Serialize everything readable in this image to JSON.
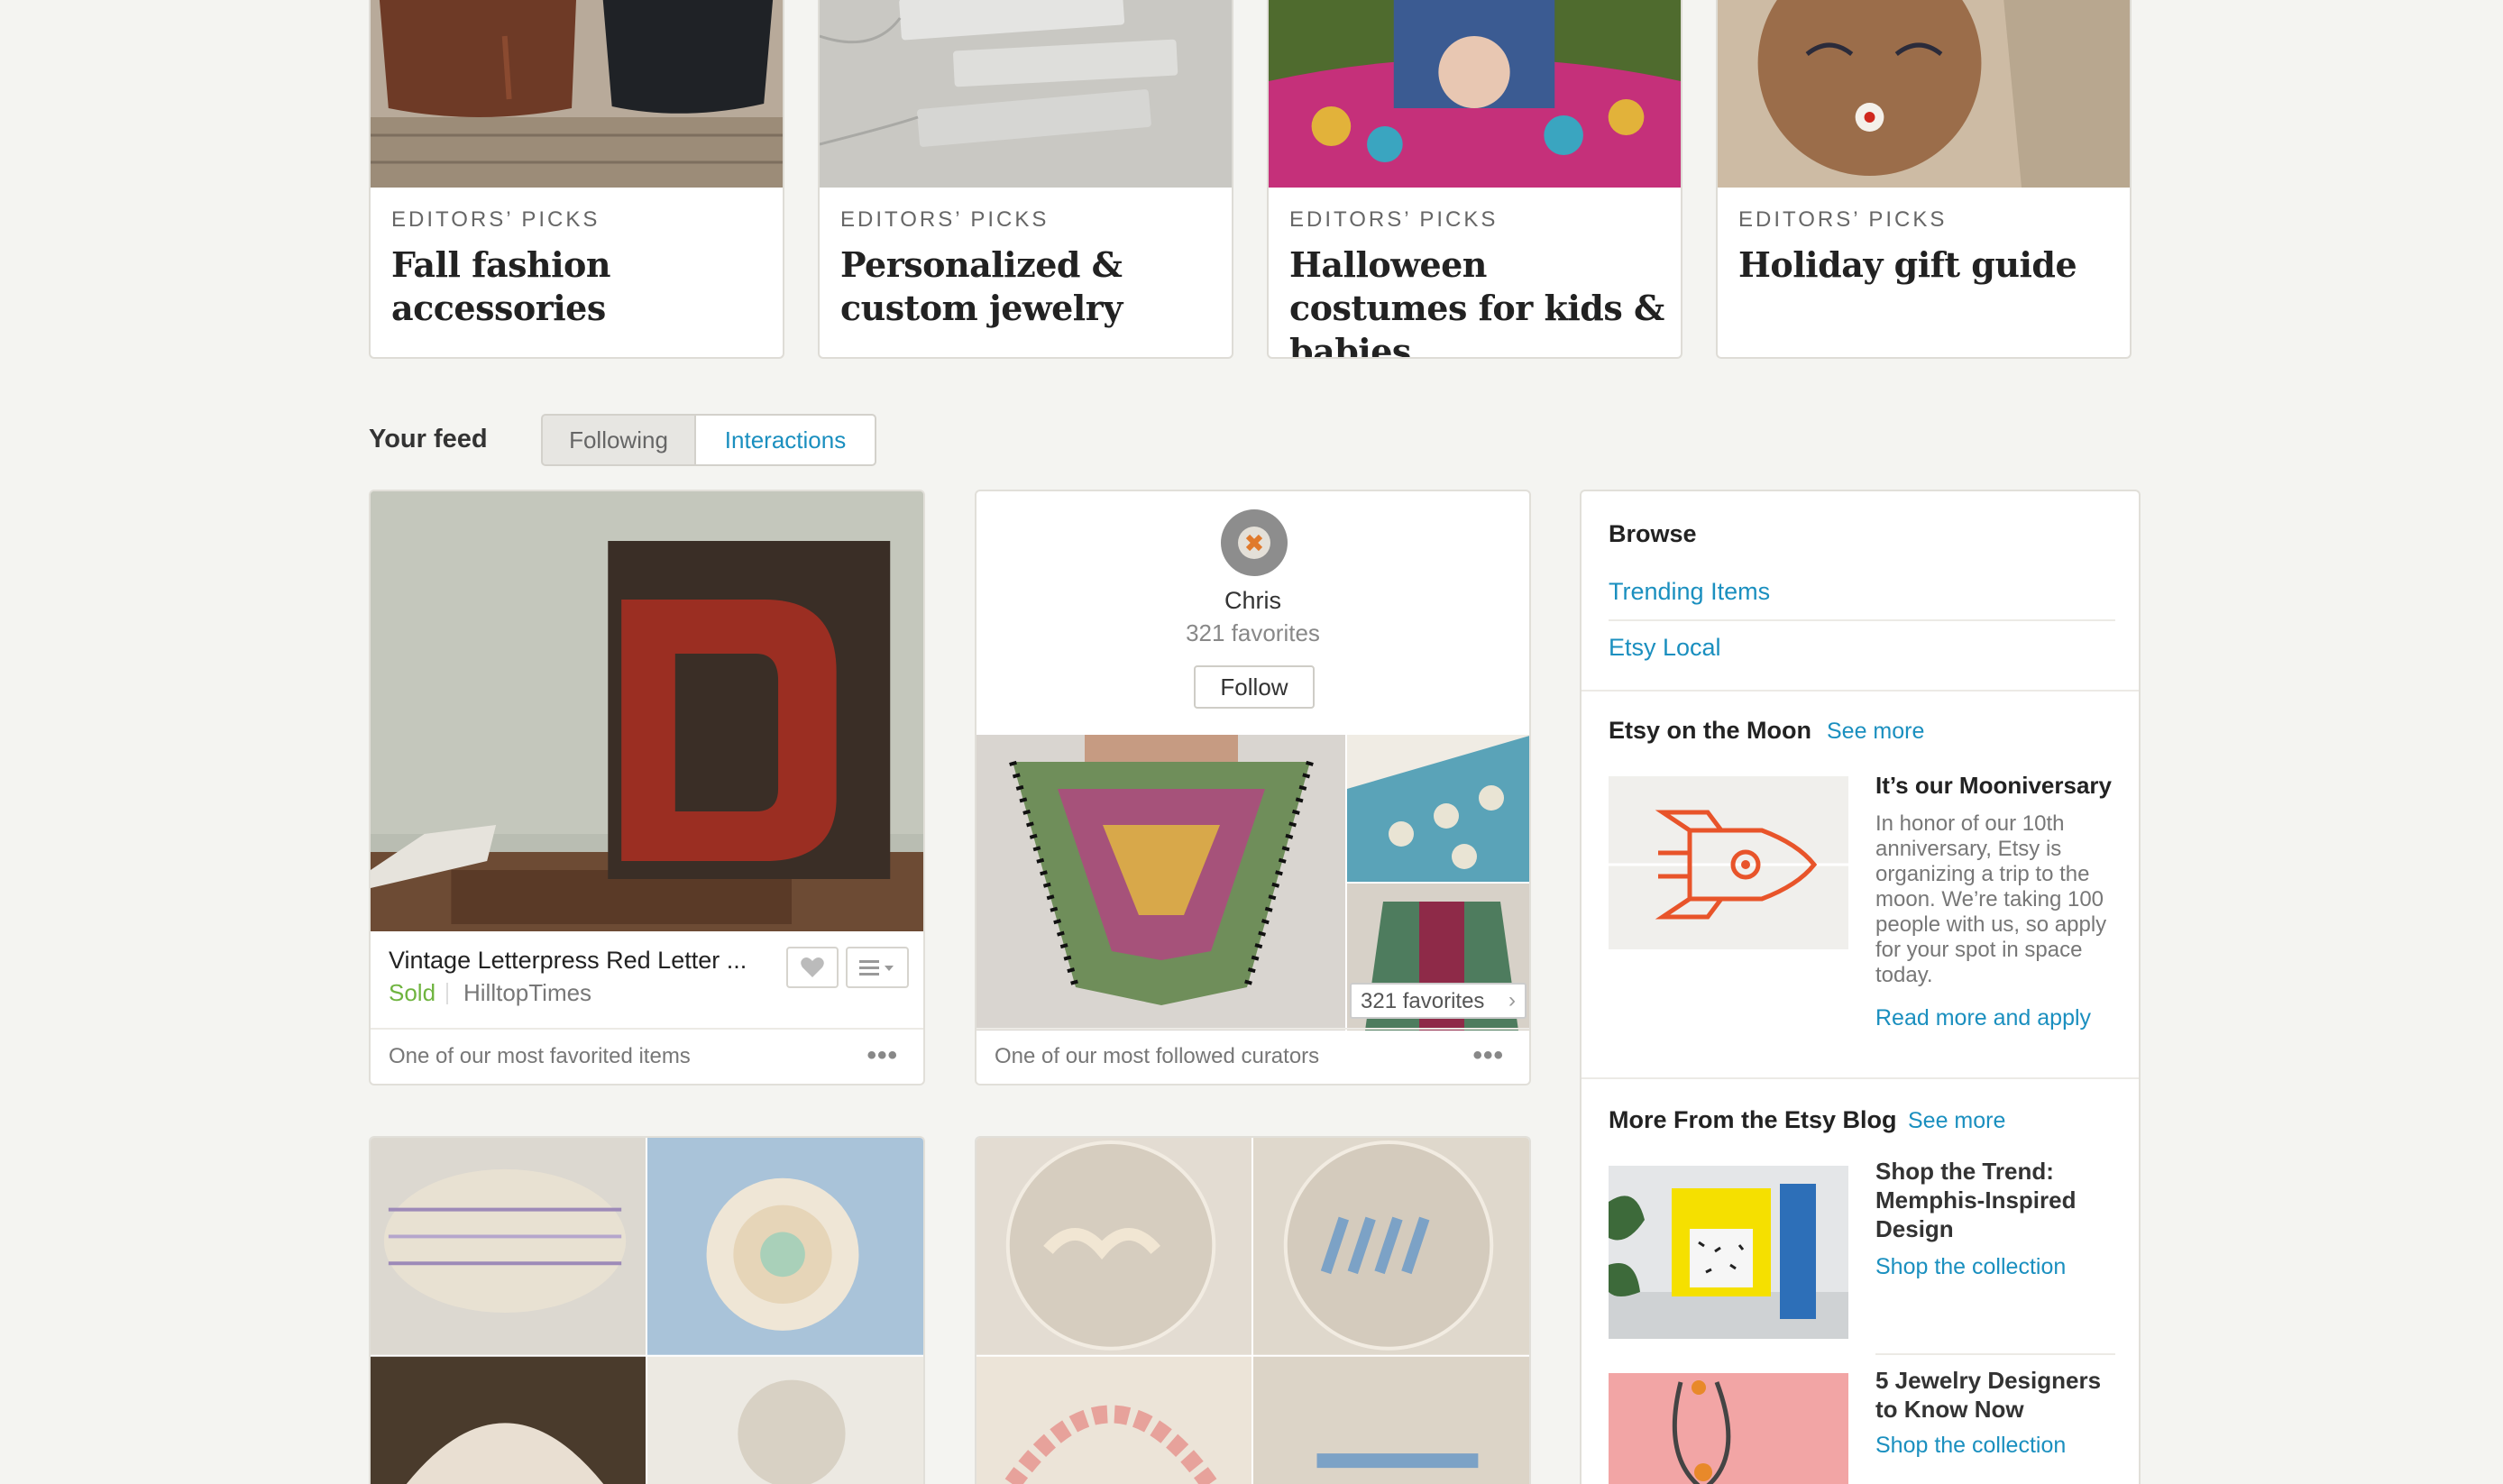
{
  "editors_picks": [
    {
      "label": "EDITORS’ PICKS",
      "title": "Fall fashion accessories"
    },
    {
      "label": "EDITORS’ PICKS",
      "title": "Personalized & custom jewelry"
    },
    {
      "label": "EDITORS’ PICKS",
      "title": "Halloween costumes for kids & babies"
    },
    {
      "label": "EDITORS’ PICKS",
      "title": "Holiday gift guide"
    }
  ],
  "feed": {
    "title": "Your feed",
    "tabs": [
      {
        "label": "Following",
        "active": true
      },
      {
        "label": "Interactions",
        "active": false
      }
    ]
  },
  "cards": {
    "listing": {
      "title": "Vintage Letterpress Red Letter ...",
      "status": "Sold",
      "shop": "HilltopTimes",
      "footer": "One of our most favorited items",
      "more": "•••"
    },
    "curator": {
      "name": "Chris",
      "favorites": "321 favorites",
      "follow_label": "Follow",
      "badge": "321 favorites",
      "footer": "One of our most followed curators",
      "more": "•••"
    }
  },
  "sidebar": {
    "browse": {
      "heading": "Browse",
      "links": [
        "Trending Items",
        "Etsy Local"
      ]
    },
    "moon": {
      "heading": "Etsy on the Moon",
      "see_more": "See more",
      "title": "It’s our Mooniversary",
      "text": "In honor of our 10th anniversary, Etsy is organizing a trip to the moon. We’re taking 100 people with us, so apply for your spot in space today.",
      "link": "Read more and apply"
    },
    "blog": {
      "heading": "More From the Etsy Blog",
      "see_more": "See more",
      "posts": [
        {
          "title": "Shop the Trend: Memphis-Inspired Design",
          "link": "Shop the collection"
        },
        {
          "title": "5 Jewelry Designers to Know Now",
          "link": "Shop the collection"
        }
      ]
    }
  },
  "colors": {
    "link": "#1a8fbf",
    "sold": "#6fb43f",
    "rocket": "#e8542a",
    "background": "#f4f4f1"
  }
}
